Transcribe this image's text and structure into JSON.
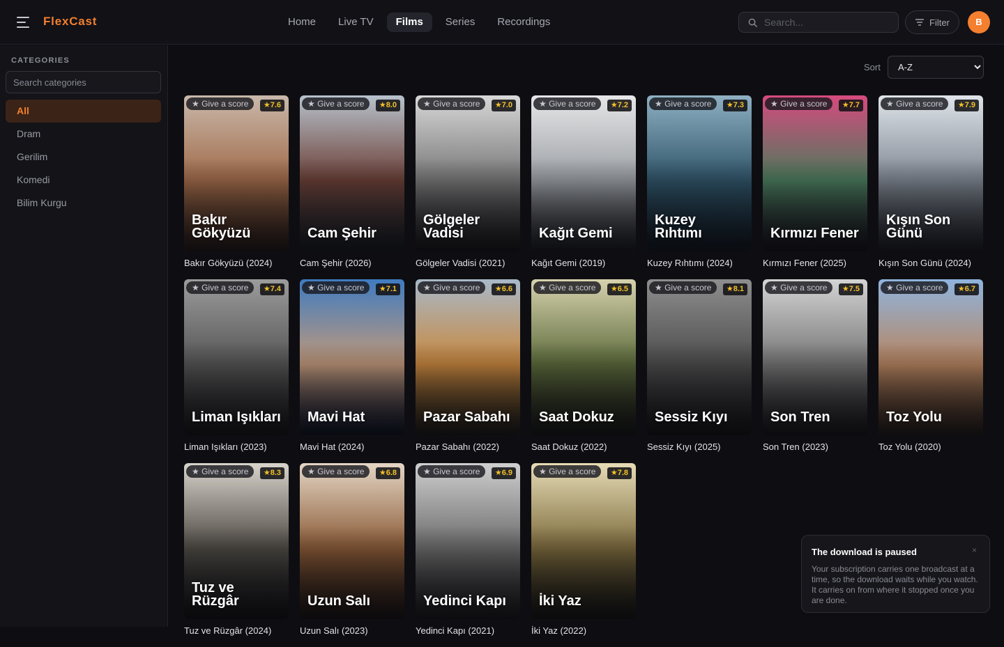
{
  "app": {
    "name": "FlexCast"
  },
  "nav": {
    "items": [
      {
        "label": "Home",
        "active": false
      },
      {
        "label": "Live TV",
        "active": false
      },
      {
        "label": "Films",
        "active": true
      },
      {
        "label": "Series",
        "active": false
      },
      {
        "label": "Recordings",
        "active": false
      }
    ]
  },
  "search": {
    "placeholder": "Search..."
  },
  "filter": {
    "label": "Filter"
  },
  "user": {
    "initial": "B"
  },
  "sidebar": {
    "heading": "CATEGORIES",
    "search_placeholder": "Search categories",
    "items": [
      {
        "label": "All",
        "active": true
      },
      {
        "label": "Dram",
        "active": false
      },
      {
        "label": "Gerilim",
        "active": false
      },
      {
        "label": "Komedi",
        "active": false
      },
      {
        "label": "Bilim Kurgu",
        "active": false
      }
    ]
  },
  "sort": {
    "label": "Sort",
    "value": "A-Z"
  },
  "score_button_label": "★ Give a score",
  "films": [
    {
      "title": "Bakır Gökyüzü",
      "year": "2024",
      "rating": "7.6",
      "colors": [
        "#c9b9ab",
        "#a06a48",
        "#3a2418"
      ]
    },
    {
      "title": "Cam Şehir",
      "year": "2026",
      "rating": "8.0",
      "colors": [
        "#b7c2cc",
        "#6b3f36",
        "#1e2a30"
      ]
    },
    {
      "title": "Gölgeler Vadisi",
      "year": "2021",
      "rating": "7.0",
      "colors": [
        "#d8d8d8",
        "#777",
        "#1d1d1d"
      ]
    },
    {
      "title": "Kağıt Gemi",
      "year": "2019",
      "rating": "7.2",
      "colors": [
        "#e7e7e9",
        "#9b9fa3",
        "#2a2c30"
      ]
    },
    {
      "title": "Kuzey Rıhtımı",
      "year": "2024",
      "rating": "7.3",
      "colors": [
        "#8fb0c3",
        "#2f5468",
        "#11202a"
      ]
    },
    {
      "title": "Kırmızı Fener",
      "year": "2025",
      "rating": "7.7",
      "colors": [
        "#d64a7e",
        "#4a7c5c",
        "#1a1420"
      ]
    },
    {
      "title": "Kışın Son Günü",
      "year": "2024",
      "rating": "7.9",
      "colors": [
        "#dfe4ea",
        "#7f8791",
        "#2b2e33"
      ]
    },
    {
      "title": "Liman Işıkları",
      "year": "2023",
      "rating": "7.4",
      "colors": [
        "#9c9c9c",
        "#555",
        "#1c1c1c"
      ]
    },
    {
      "title": "Mavi Hat",
      "year": "2024",
      "rating": "7.1",
      "colors": [
        "#3f7bc0",
        "#c39a7a",
        "#0d1a38"
      ]
    },
    {
      "title": "Pazar Sabahı",
      "year": "2022",
      "rating": "6.6",
      "colors": [
        "#a8b9c8",
        "#c9873d",
        "#2b2618"
      ]
    },
    {
      "title": "Saat Dokuz",
      "year": "2022",
      "rating": "6.5",
      "colors": [
        "#d7d2ae",
        "#5c6a3a",
        "#1c1e14"
      ]
    },
    {
      "title": "Sessiz Kıyı",
      "year": "2025",
      "rating": "8.1",
      "colors": [
        "#8e8e8e",
        "#4c4c4c",
        "#181818"
      ]
    },
    {
      "title": "Son Tren",
      "year": "2023",
      "rating": "7.5",
      "colors": [
        "#d4d4d4",
        "#757575",
        "#1e1e1e"
      ]
    },
    {
      "title": "Toz Yolu",
      "year": "2020",
      "rating": "6.7",
      "colors": [
        "#8fb4de",
        "#b8845e",
        "#3b2a1c"
      ]
    },
    {
      "title": "Tuz ve Rüzgâr",
      "year": "2024",
      "rating": "8.3",
      "colors": [
        "#d8d4cc",
        "#4e4a44",
        "#141414"
      ]
    },
    {
      "title": "Uzun Salı",
      "year": "2023",
      "rating": "6.8",
      "colors": [
        "#e4d6c5",
        "#8a5a36",
        "#24180f"
      ]
    },
    {
      "title": "Yedinci Kapı",
      "year": "2021",
      "rating": "6.9",
      "colors": [
        "#cfcfcf",
        "#6b6b6b",
        "#222"
      ]
    },
    {
      "title": "İki Yaz",
      "year": "2022",
      "rating": "7.8",
      "colors": [
        "#e6dcb6",
        "#7c6a3c",
        "#1c1a10"
      ]
    }
  ],
  "toast": {
    "title": "The download is paused",
    "message": "Your subscription carries one broadcast at a time, so the download waits while you watch. It carries on from where it stopped once you are done.",
    "close": "×"
  }
}
